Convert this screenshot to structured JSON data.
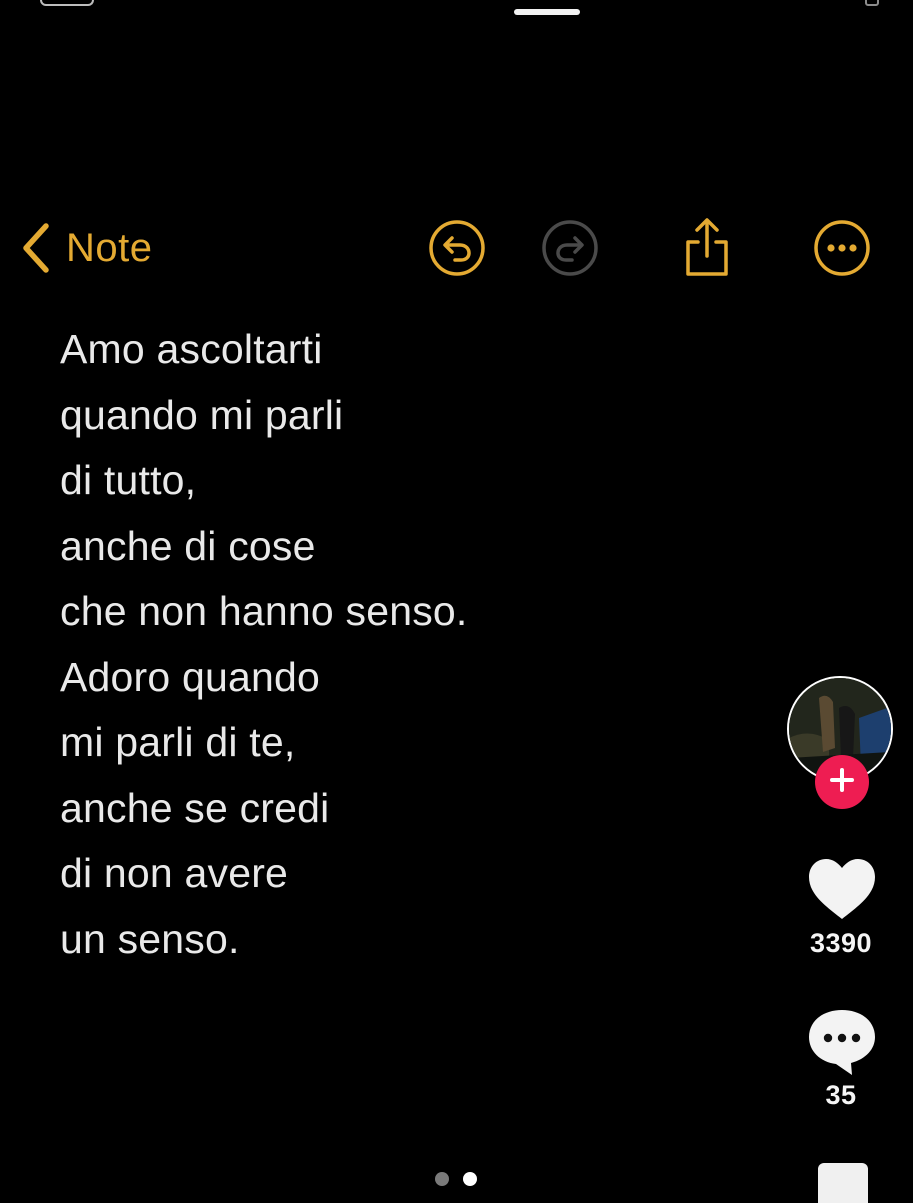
{
  "colors": {
    "accent": "#e4aa32",
    "disabled_icon": "#4a4a4a",
    "note_text": "#e9e9e9",
    "background": "#000000",
    "follow_red": "#ee1d52"
  },
  "toolbar": {
    "back_label": "Note",
    "icons": [
      "chevron-left-icon",
      "undo-icon",
      "redo-icon",
      "share-icon",
      "more-icon"
    ],
    "redo_enabled": false
  },
  "note": {
    "lines": [
      "Amo ascoltarti",
      "quando mi parli",
      "di tutto,",
      "anche di cose",
      "che non hanno senso.",
      "Adoro quando",
      "mi parli di te,",
      "anche se credi",
      "di non avere",
      "un senso."
    ]
  },
  "side_rail": {
    "likes": "3390",
    "comments": "35",
    "icons": [
      "avatar",
      "plus-icon",
      "heart-icon",
      "comment-icon",
      "share-icon"
    ]
  },
  "pager": {
    "count": 2,
    "active_index": 1
  }
}
